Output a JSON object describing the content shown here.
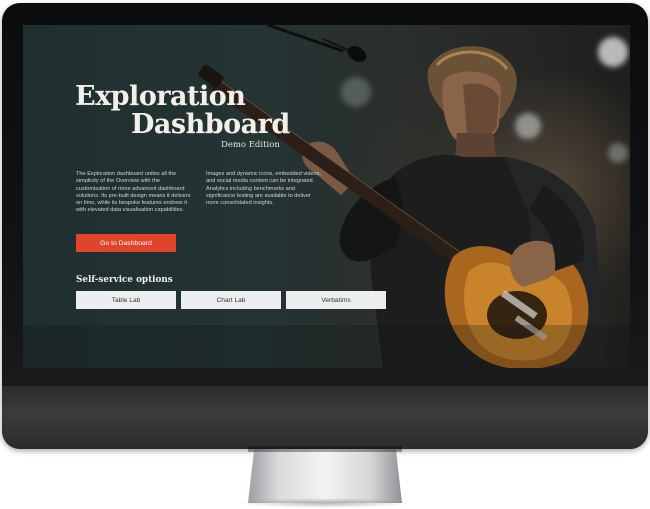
{
  "hero": {
    "title_line1": "Exploration",
    "title_line2": "Dashboard",
    "subtitle": "Demo Edition"
  },
  "intro": {
    "left_text": "The Exploration dashboard unites all the simplicity of the Overview with the customisation of more advanced dashboard solutions. Its pre-built design means it delivers on time, while its bespoke features endows it with elevated data visualisation capabilities.",
    "right_text": "Images and dynamic icons, embedded videos, and social media content can be integrated. Analytics including benchmarks and significance testing are available to deliver more consolidated insights."
  },
  "cta": {
    "label": "Go to Dashboard",
    "color": "#e0452b"
  },
  "self_service": {
    "heading": "Self-service options",
    "options": [
      "Table Lab",
      "Chart Lab",
      "Verbatims"
    ]
  },
  "colors": {
    "screen_background": "#243434",
    "button_background": "#eceeef",
    "text_light": "#f3f0ea"
  }
}
